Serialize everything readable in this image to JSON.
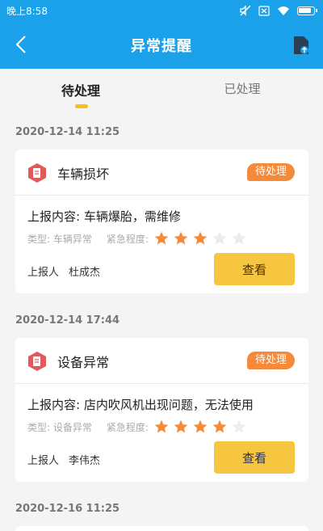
{
  "status_bar": {
    "time": "晚上8:58"
  },
  "header": {
    "title": "异常提醒"
  },
  "tabs": [
    {
      "label": "待处理",
      "active": true
    },
    {
      "label": "已处理",
      "active": false
    }
  ],
  "colors": {
    "header": "#1aa1e9",
    "badge": "#f58a3a",
    "view_button": "#f7c641",
    "star_active": "#f58a3a",
    "star_inactive": "#ececec"
  },
  "records": [
    {
      "date": "2020-12-14 11:25",
      "title": "车辆损坏",
      "status": "待处理",
      "content": "上报内容: 车辆爆胎，需维修",
      "type_text": "类型: 车辆异常",
      "urgency_label": "紧急程度:",
      "urgency": 3,
      "urgency_max": 5,
      "reporter_label": "上报人",
      "reporter_name": "杜成杰",
      "view_label": "查看"
    },
    {
      "date": "2020-12-14 17:44",
      "title": "设备异常",
      "status": "待处理",
      "content": "上报内容: 店内吹风机出现问题，无法使用",
      "type_text": "类型: 设备异常",
      "urgency_label": "紧急程度:",
      "urgency": 4,
      "urgency_max": 5,
      "reporter_label": "上报人",
      "reporter_name": "李伟杰",
      "view_label": "查看"
    },
    {
      "date": "2020-12-16 11:25"
    }
  ]
}
